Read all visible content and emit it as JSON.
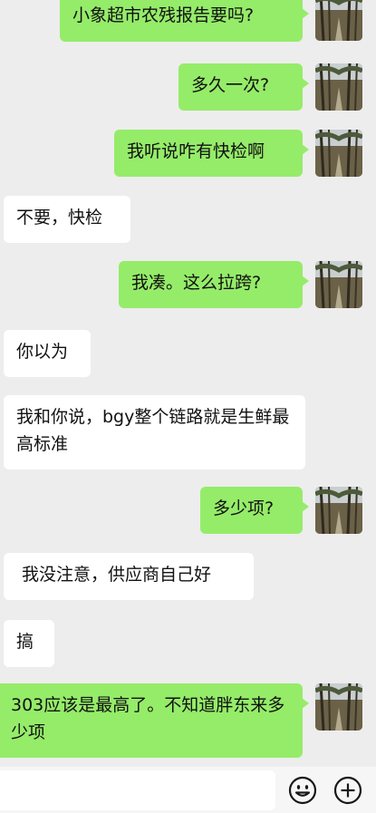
{
  "messages": [
    {
      "side": "sent",
      "text": "小象超市农残报告要吗?"
    },
    {
      "side": "sent",
      "text": "多久一次?"
    },
    {
      "side": "sent",
      "text": "我听说咋有快检啊"
    },
    {
      "side": "recv",
      "text": "不要，快检"
    },
    {
      "side": "sent",
      "text": "我凑。这么拉跨?"
    },
    {
      "side": "recv",
      "text": "你以为"
    },
    {
      "side": "recv",
      "text": "我和你说，bgy整个链路就是生鲜最高标准"
    },
    {
      "side": "sent",
      "text": "多少项?"
    },
    {
      "side": "recv",
      "text": "我没注意，供应商自己好"
    },
    {
      "side": "recv",
      "text": "搞"
    },
    {
      "side": "sent",
      "text": "303应该是最高了。不知道胖东来多少项"
    }
  ],
  "icons": {
    "avatar": "forest-photo-avatar",
    "emoji": "smiley-face-icon",
    "more": "plus-circle-icon"
  },
  "colors": {
    "background": "#ededed",
    "sent_bubble": "#95ec69",
    "recv_bubble": "#ffffff",
    "text": "#111111"
  }
}
